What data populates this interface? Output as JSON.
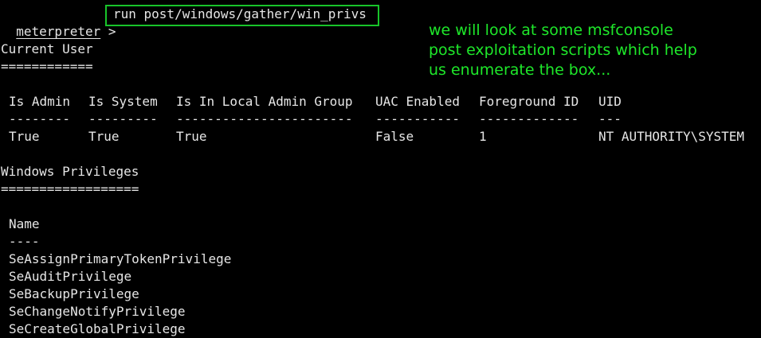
{
  "prompt": {
    "word": "meterpreter",
    "symbol": ">",
    "command": "run post/windows/gather/win_privs"
  },
  "annotation": {
    "lines": [
      "we will look at some msfconsole",
      "post exploitation scripts which help",
      "us enumerate the box..."
    ],
    "color": "#1ee82a"
  },
  "current_user": {
    "heading": "Current User",
    "underline": "============",
    "columns": [
      {
        "header": "Is Admin",
        "dashes": "--------",
        "value": "True"
      },
      {
        "header": "Is System",
        "dashes": "---------",
        "value": "True"
      },
      {
        "header": "Is In Local Admin Group",
        "dashes": "-----------------------",
        "value": "True"
      },
      {
        "header": "UAC Enabled",
        "dashes": "-----------",
        "value": "False"
      },
      {
        "header": "Foreground ID",
        "dashes": "-------------",
        "value": "1"
      },
      {
        "header": "UID",
        "dashes": "---",
        "value": "NT AUTHORITY\\SYSTEM"
      }
    ]
  },
  "windows_privileges": {
    "heading": "Windows Privileges",
    "underline": "==================",
    "name_header": "Name",
    "name_dashes": "----",
    "items": [
      "SeAssignPrimaryTokenPrivilege",
      "SeAuditPrivilege",
      "SeBackupPrivilege",
      "SeChangeNotifyPrivilege",
      "SeCreateGlobalPrivilege"
    ]
  },
  "colors": {
    "background": "#000000",
    "text": "#e6e6e6",
    "highlight_box": "#18c42a"
  }
}
